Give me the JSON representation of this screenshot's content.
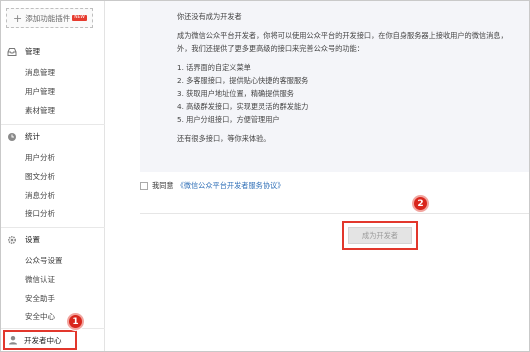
{
  "sidebar": {
    "add_plugin": {
      "label": "添加功能插件",
      "badge": "NEW"
    },
    "sections": [
      {
        "title": "管理",
        "icon": "inbox-icon",
        "items": [
          "消息管理",
          "用户管理",
          "素材管理"
        ]
      },
      {
        "title": "统计",
        "icon": "clock-icon",
        "items": [
          "用户分析",
          "图文分析",
          "消息分析",
          "接口分析"
        ]
      },
      {
        "title": "设置",
        "icon": "gear-icon",
        "items": [
          "公众号设置",
          "微信认证",
          "安全助手",
          "安全中心"
        ]
      }
    ],
    "dev_center": {
      "label": "开发者中心",
      "icon": "person-icon"
    }
  },
  "main": {
    "intro_title": "你还没有成为开发者",
    "intro_lines": [
      "成为微信公众平台开发者，你将可以使用公众平台的开发接口，在你自身服务器上接收用户的微信消息，",
      "外，我们还提供了更多更高级的接口来完善公众号的功能："
    ],
    "features": [
      "1. 话界面的自定义菜单",
      "2. 多客服接口，提供贴心快捷的客服服务",
      "3. 获取用户地址位置，精确提供服务",
      "4. 高级群发接口，实现更灵活的群发能力",
      "5. 用户分组接口，方便管理用户"
    ],
    "more_text": "还有很多接口，等你来体验。",
    "agree_label": "我同意",
    "agreement_link": "《微信公众平台开发者服务协议》",
    "become_button": "成为开发者"
  },
  "annotations": {
    "step1": "1",
    "step2": "2"
  },
  "colors": {
    "highlight": "#e2372c",
    "badge": "#d9261c",
    "link": "#2f6fb7",
    "info_bg": "#f4f5f9"
  }
}
